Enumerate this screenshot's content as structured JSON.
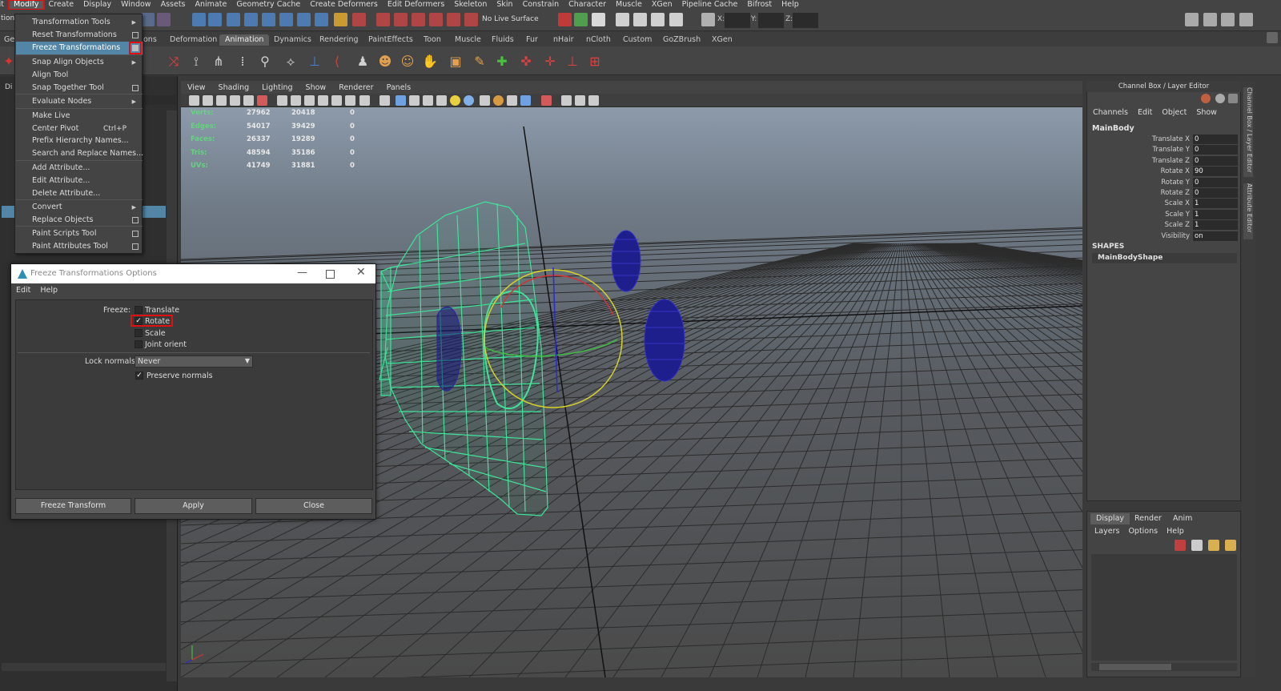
{
  "menubar": {
    "items": [
      {
        "label": "iit"
      },
      {
        "label": "Modify",
        "active": true
      },
      {
        "label": "Create"
      },
      {
        "label": "Display"
      },
      {
        "label": "Window"
      },
      {
        "label": "Assets"
      },
      {
        "label": "Animate"
      },
      {
        "label": "Geometry Cache"
      },
      {
        "label": "Create Deformers"
      },
      {
        "label": "Edit Deformers"
      },
      {
        "label": "Skeleton"
      },
      {
        "label": "Skin"
      },
      {
        "label": "Constrain"
      },
      {
        "label": "Character"
      },
      {
        "label": "Muscle"
      },
      {
        "label": "XGen"
      },
      {
        "label": "Pipeline Cache"
      },
      {
        "label": "Bifrost"
      },
      {
        "label": "Help"
      }
    ]
  },
  "statusline": {
    "mode_label": "tion",
    "live_surface": "No Live Surface",
    "x_label": "X:",
    "y_label": "Y:",
    "z_label": "Z:"
  },
  "shelf": {
    "left_label": "Gen",
    "tabs": [
      "ons",
      "Deformation",
      "Animation",
      "Dynamics",
      "Rendering",
      "PaintEffects",
      "Toon",
      "Muscle",
      "Fluids",
      "Fur",
      "nHair",
      "nCloth",
      "Custom",
      "GoZBrush",
      "XGen"
    ],
    "active_tab": "Animation"
  },
  "outliner": {
    "top_label": "Di"
  },
  "modify_menu": {
    "items": [
      {
        "label": "Transformation Tools",
        "submenu": true
      },
      {
        "label": "Reset Transformations",
        "option_box": true
      },
      {
        "label": "Freeze Transformations",
        "option_box": true,
        "highlighted": true
      },
      {
        "label": "Snap Align Objects",
        "submenu": true
      },
      {
        "label": "Align Tool"
      },
      {
        "label": "Snap Together Tool",
        "option_box": true
      },
      {
        "label": "Evaluate Nodes",
        "submenu": true
      },
      {
        "label": "Make Live"
      },
      {
        "label": "Center Pivot",
        "shortcut": "Ctrl+P"
      },
      {
        "label": "Prefix Hierarchy Names..."
      },
      {
        "label": "Search and Replace Names..."
      },
      {
        "label": "Add Attribute..."
      },
      {
        "label": "Edit Attribute..."
      },
      {
        "label": "Delete Attribute..."
      },
      {
        "label": "Convert",
        "submenu": true
      },
      {
        "label": "Replace Objects",
        "option_box": true
      },
      {
        "label": "Paint Scripts Tool",
        "option_box": true
      },
      {
        "label": "Paint Attributes Tool",
        "option_box": true
      }
    ]
  },
  "dialog": {
    "title": "Freeze Transformations Options",
    "menu": [
      "Edit",
      "Help"
    ],
    "freeze_label": "Freeze:",
    "options": [
      {
        "label": "Translate",
        "checked": false
      },
      {
        "label": "Rotate",
        "checked": true
      },
      {
        "label": "Scale",
        "checked": false
      },
      {
        "label": "Joint orient",
        "checked": false
      }
    ],
    "lock_normals_label": "Lock normals:",
    "lock_normals_value": "Never",
    "preserve_normals_label": "Preserve normals",
    "preserve_normals_checked": true,
    "buttons": [
      "Freeze Transform",
      "Apply",
      "Close"
    ],
    "checkmark": "✓"
  },
  "viewport": {
    "menu": [
      "View",
      "Shading",
      "Lighting",
      "Show",
      "Renderer",
      "Panels"
    ],
    "hud": [
      {
        "label": "Verts:",
        "a": "27962",
        "b": "20418",
        "c": "0"
      },
      {
        "label": "Edges:",
        "a": "54017",
        "b": "39429",
        "c": "0"
      },
      {
        "label": "Faces:",
        "a": "26337",
        "b": "19289",
        "c": "0"
      },
      {
        "label": "Tris:",
        "a": "48594",
        "b": "35186",
        "c": "0"
      },
      {
        "label": "UVs:",
        "a": "41749",
        "b": "31881",
        "c": "0"
      }
    ]
  },
  "channel_box": {
    "title": "Channel Box / Layer Editor",
    "menu": [
      "Channels",
      "Edit",
      "Object",
      "Show"
    ],
    "node": "MainBody",
    "attributes": [
      {
        "name": "Translate X",
        "value": "0"
      },
      {
        "name": "Translate Y",
        "value": "0"
      },
      {
        "name": "Translate Z",
        "value": "0"
      },
      {
        "name": "Rotate X",
        "value": "90"
      },
      {
        "name": "Rotate Y",
        "value": "0"
      },
      {
        "name": "Rotate Z",
        "value": "0"
      },
      {
        "name": "Scale X",
        "value": "1"
      },
      {
        "name": "Scale Y",
        "value": "1"
      },
      {
        "name": "Scale Z",
        "value": "1"
      },
      {
        "name": "Visibility",
        "value": "on"
      }
    ],
    "shapes_header": "SHAPES",
    "shape_name": "MainBodyShape",
    "side_tabs": [
      "Channel Box / Layer Editor",
      "Attribute Editor"
    ]
  },
  "layer_editor": {
    "tabs": [
      "Display",
      "Render",
      "Anim"
    ],
    "active_tab": "Display",
    "menu": [
      "Layers",
      "Options",
      "Help"
    ]
  },
  "colors": {
    "wireframe": "#3fe39a",
    "wheels": "#1e1e8c",
    "highlight": "#e01010",
    "menu_highlight": "#5285a6"
  }
}
